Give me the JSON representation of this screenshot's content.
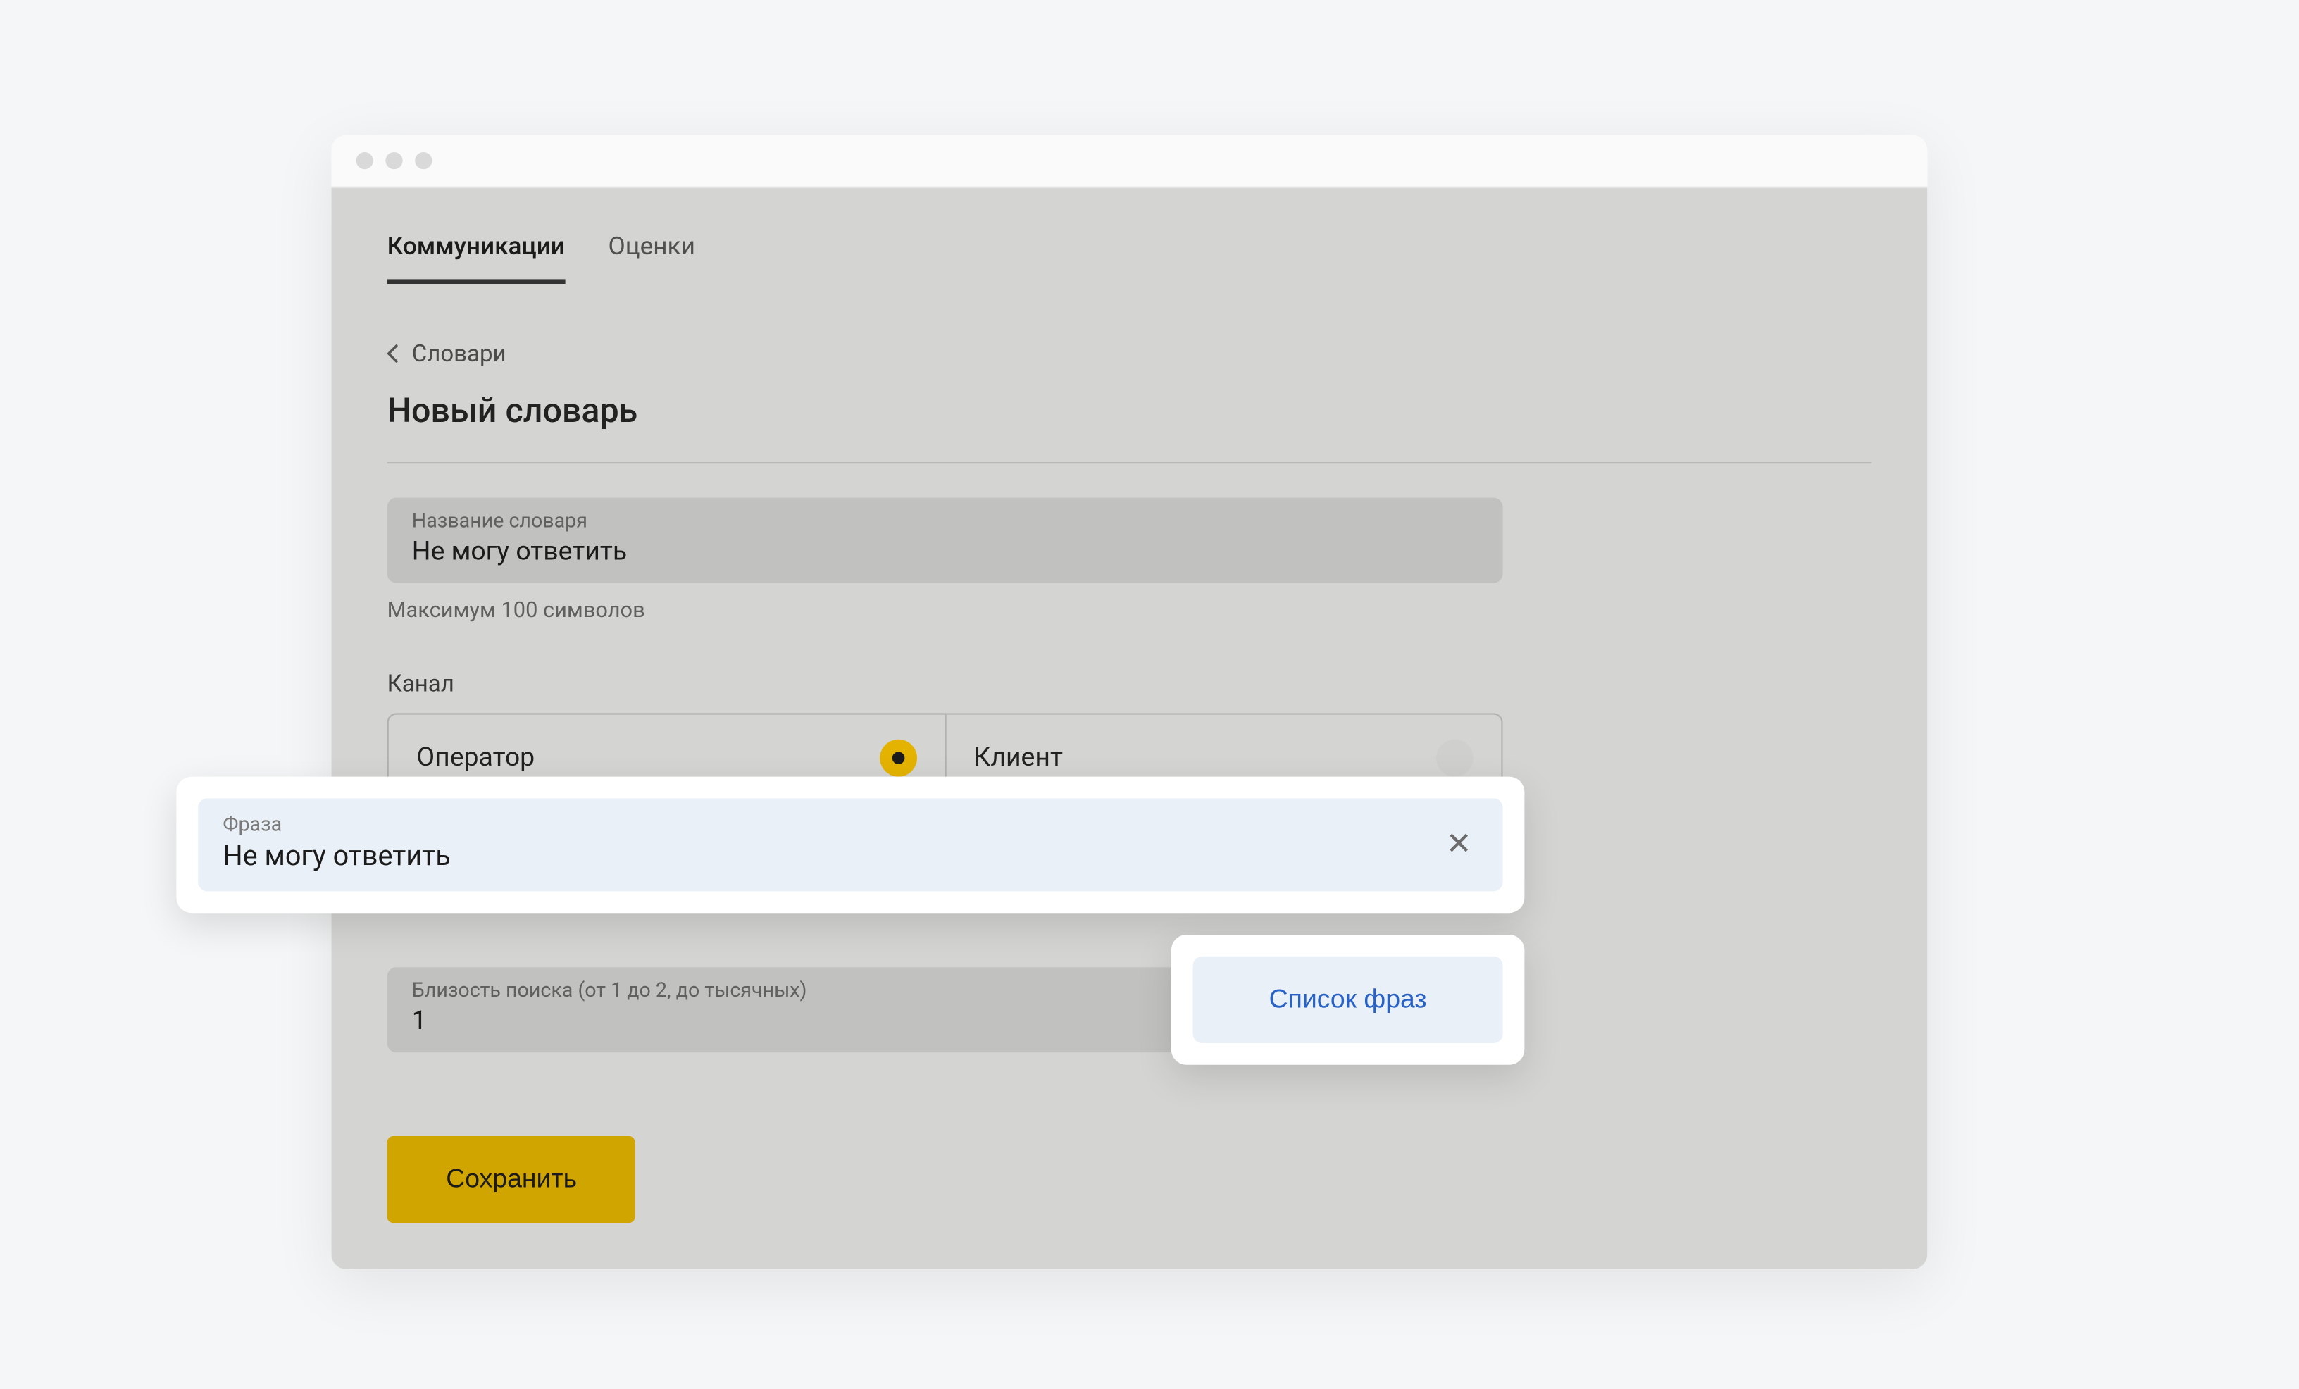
{
  "tabs": {
    "communications": "Коммуникации",
    "ratings": "Оценки"
  },
  "breadcrumb": {
    "label": "Словари"
  },
  "page": {
    "title": "Новый словарь"
  },
  "dictionary_name": {
    "label": "Название словаря",
    "value": "Не могу ответить",
    "helper": "Максимум 100 символов"
  },
  "channel": {
    "section_label": "Канал",
    "operator": "Оператор",
    "client": "Клиент"
  },
  "phrase": {
    "label": "Фраза",
    "value": "Не могу ответить"
  },
  "proximity": {
    "label": "Близость поиска (от 1 до 2, до тысячных)",
    "value": "1"
  },
  "phrase_list_button": "Список фраз",
  "save_button": "Сохранить"
}
